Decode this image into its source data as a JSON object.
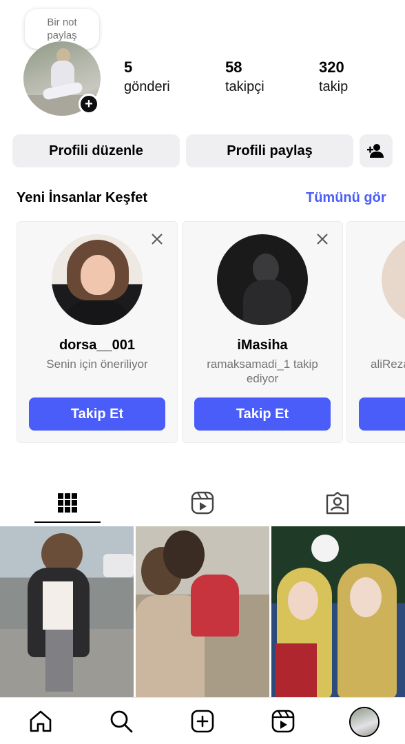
{
  "note": {
    "text_line1": "Bir not",
    "text_line2": "paylaş"
  },
  "profile": {
    "avatar_icon": "profile-avatar",
    "add_story_glyph": "+"
  },
  "stats": [
    {
      "value": "5",
      "label": "gönderi"
    },
    {
      "value": "58",
      "label": "takipçi"
    },
    {
      "value": "320",
      "label": "takip"
    }
  ],
  "actions": {
    "edit_profile": "Profili düzenle",
    "share_profile": "Profili paylaş",
    "add_person_icon": "person-add-icon"
  },
  "discover": {
    "title": "Yeni İnsanlar Keşfet",
    "see_all": "Tümünü gör",
    "cards": [
      {
        "name": "dorsa__001",
        "subtitle": "Senin için öneriliyor",
        "button": "Takip Et"
      },
      {
        "name": "iMasiha",
        "subtitle": "ramaksamadi_1 takip ediyor",
        "button": "Takip Et"
      },
      {
        "name": "",
        "subtitle": "aliReza",
        "button": "T"
      }
    ]
  },
  "tabs": [
    {
      "icon": "grid-icon",
      "active": true
    },
    {
      "icon": "reels-icon",
      "active": false
    },
    {
      "icon": "tagged-icon",
      "active": false
    }
  ],
  "bottom_nav": [
    {
      "icon": "home-icon"
    },
    {
      "icon": "search-icon"
    },
    {
      "icon": "create-icon"
    },
    {
      "icon": "reels-icon"
    },
    {
      "icon": "profile-avatar"
    }
  ],
  "colors": {
    "accent": "#4a5df9",
    "button_grey": "#efeff1",
    "muted_text": "#737373"
  }
}
